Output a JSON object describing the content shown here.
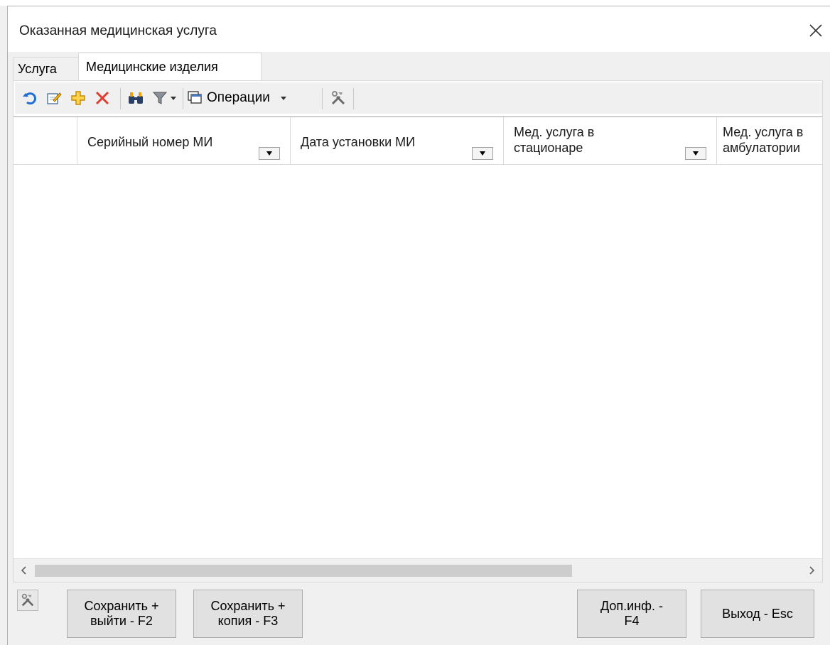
{
  "window": {
    "title": "Оказанная медицинская услуга"
  },
  "tabs": [
    {
      "label": "Услуга"
    },
    {
      "label": "Медицинские изделия"
    }
  ],
  "toolbar": {
    "operations_label": "Операции",
    "icons": [
      "refresh-icon",
      "edit-icon",
      "add-icon",
      "delete-icon",
      "find-icon",
      "filter-icon",
      "operations-icon",
      "tools-icon"
    ]
  },
  "grid": {
    "columns": [
      {
        "label": "Серийный номер МИ"
      },
      {
        "label": "Дата установки МИ"
      },
      {
        "label": "Мед. услуга в стационаре"
      },
      {
        "label": "Мед. услуга в амбулатории"
      }
    ],
    "rows": []
  },
  "footer": {
    "save_exit": "Сохранить +\nвыйти - F2",
    "save_copy": "Сохранить +\nкопия - F3",
    "extra_info": "Доп.инф. -\nF4",
    "exit": "Выход - Esc"
  }
}
